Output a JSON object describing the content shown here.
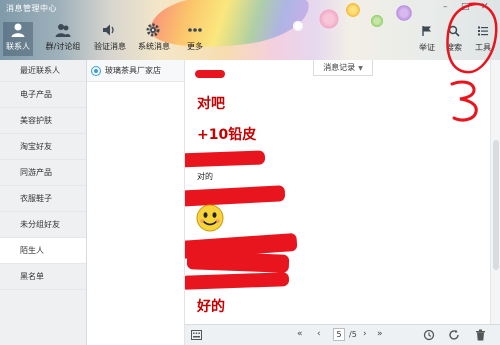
{
  "window": {
    "title": "消息管理中心",
    "controls": [
      "–",
      "□",
      "✕"
    ]
  },
  "header_tabs": [
    {
      "label": "联系人",
      "icon": "person-icon",
      "active": true
    },
    {
      "label": "群/讨论组",
      "icon": "group-icon",
      "active": false
    },
    {
      "label": "验证消息",
      "icon": "speaker-icon",
      "active": false
    },
    {
      "label": "系统消息",
      "icon": "gear-icon",
      "active": false
    },
    {
      "label": "更多",
      "icon": "more-dots-icon",
      "active": false
    }
  ],
  "right_tools": [
    {
      "label": "举证",
      "icon": "flag-icon"
    },
    {
      "label": "搜索",
      "icon": "search-icon"
    },
    {
      "label": "工具",
      "icon": "list-icon"
    }
  ],
  "sidebar": {
    "items": [
      {
        "label": "最近联系人"
      },
      {
        "label": "电子产品"
      },
      {
        "label": "美容护肤"
      },
      {
        "label": "淘宝好友"
      },
      {
        "label": "同游产品"
      },
      {
        "label": "衣服鞋子"
      },
      {
        "label": "未分组好友"
      },
      {
        "label": "陌生人",
        "active": true
      },
      {
        "label": "黑名单"
      }
    ]
  },
  "contacts": [
    {
      "name": "玻璃茶具厂家店"
    }
  ],
  "messages": {
    "tab_label": "消息记录",
    "lines": [
      {
        "text": "对吧",
        "style": "big"
      },
      {
        "text": "+10铅皮",
        "style": "big"
      },
      {
        "text": "对的",
        "style": "small"
      },
      {
        "text": "好的",
        "style": "big"
      }
    ],
    "emoji": "smiley-emoji"
  },
  "pagination": {
    "current": "5",
    "total": "/5"
  },
  "annotation": {
    "number": "3"
  },
  "colors": {
    "accent_red": "#e8141e",
    "message_red": "#c40000",
    "sidebar_bg": "#eef0f2"
  }
}
